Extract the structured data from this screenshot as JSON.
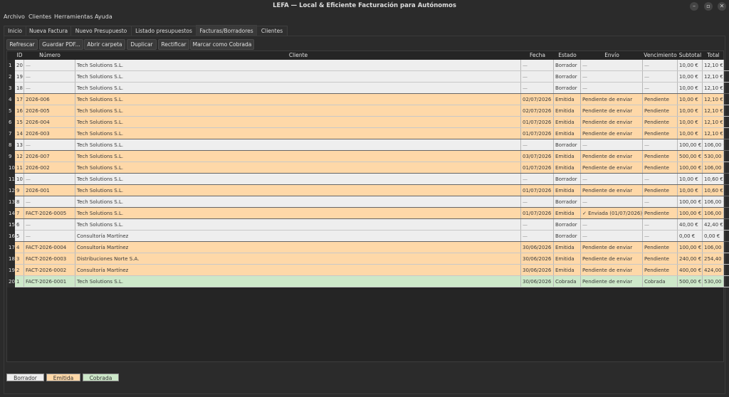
{
  "window": {
    "title": "LEFA — Local & Eficiente Facturación para Autónomos"
  },
  "menu": [
    "Archivo",
    "Clientes",
    "Herramientas",
    "Ayuda"
  ],
  "tabs": [
    "Inicio",
    "Nueva Factura",
    "Nuevo Presupuesto",
    "Listado presupuestos",
    "Facturas/Borradores",
    "Clientes"
  ],
  "active_tab": "Facturas/Borradores",
  "toolbar": [
    "Refrescar",
    "Guardar PDF...",
    "Abrir carpeta",
    "Duplicar",
    "Rectificar",
    "Marcar como Cobrada"
  ],
  "columns": [
    "ID",
    "Número",
    "Cliente",
    "Fecha",
    "Estado",
    "Envío",
    "Vencimiento",
    "Subtotal",
    "Total"
  ],
  "colors": {
    "borrador": "#eeeeee",
    "emitida": "#fed8a8",
    "cobrada": "#cde8c9"
  },
  "rows": [
    {
      "n": "1",
      "id": "20",
      "numero": "—",
      "cliente": "Tech Solutions S.L.",
      "fecha": "—",
      "estado": "Borrador",
      "envio": "—",
      "venc": "—",
      "subtotal": "10,00 €",
      "total": "12,10 €"
    },
    {
      "n": "2",
      "id": "19",
      "numero": "—",
      "cliente": "Tech Solutions S.L.",
      "fecha": "—",
      "estado": "Borrador",
      "envio": "—",
      "venc": "—",
      "subtotal": "10,00 €",
      "total": "12,10 €"
    },
    {
      "n": "3",
      "id": "18",
      "numero": "—",
      "cliente": "Tech Solutions S.L.",
      "fecha": "—",
      "estado": "Borrador",
      "envio": "—",
      "venc": "—",
      "subtotal": "10,00 €",
      "total": "12,10 €"
    },
    {
      "n": "4",
      "id": "17",
      "numero": "2026-006",
      "cliente": "Tech Solutions S.L.",
      "fecha": "02/07/2026",
      "estado": "Emitida",
      "envio": "Pendiente de enviar",
      "venc": "Pendiente",
      "subtotal": "10,00 €",
      "total": "12,10 €"
    },
    {
      "n": "5",
      "id": "16",
      "numero": "2026-005",
      "cliente": "Tech Solutions S.L.",
      "fecha": "02/07/2026",
      "estado": "Emitida",
      "envio": "Pendiente de enviar",
      "venc": "Pendiente",
      "subtotal": "10,00 €",
      "total": "12,10 €"
    },
    {
      "n": "6",
      "id": "15",
      "numero": "2026-004",
      "cliente": "Tech Solutions S.L.",
      "fecha": "01/07/2026",
      "estado": "Emitida",
      "envio": "Pendiente de enviar",
      "venc": "Pendiente",
      "subtotal": "10,00 €",
      "total": "12,10 €"
    },
    {
      "n": "7",
      "id": "14",
      "numero": "2026-003",
      "cliente": "Tech Solutions S.L.",
      "fecha": "01/07/2026",
      "estado": "Emitida",
      "envio": "Pendiente de enviar",
      "venc": "Pendiente",
      "subtotal": "10,00 €",
      "total": "12,10 €"
    },
    {
      "n": "8",
      "id": "13",
      "numero": "—",
      "cliente": "Tech Solutions S.L.",
      "fecha": "—",
      "estado": "Borrador",
      "envio": "—",
      "venc": "—",
      "subtotal": "100,00 €",
      "total": "106,00 €"
    },
    {
      "n": "9",
      "id": "12",
      "numero": "2026-007",
      "cliente": "Tech Solutions S.L.",
      "fecha": "03/07/2026",
      "estado": "Emitida",
      "envio": "Pendiente de enviar",
      "venc": "Pendiente",
      "subtotal": "500,00 €",
      "total": "530,00 €"
    },
    {
      "n": "10",
      "id": "11",
      "numero": "2026-002",
      "cliente": "Tech Solutions S.L.",
      "fecha": "01/07/2026",
      "estado": "Emitida",
      "envio": "Pendiente de enviar",
      "venc": "Pendiente",
      "subtotal": "100,00 €",
      "total": "106,00 €"
    },
    {
      "n": "11",
      "id": "10",
      "numero": "—",
      "cliente": "Tech Solutions S.L.",
      "fecha": "—",
      "estado": "Borrador",
      "envio": "—",
      "venc": "—",
      "subtotal": "10,00 €",
      "total": "10,60 €"
    },
    {
      "n": "12",
      "id": "9",
      "numero": "2026-001",
      "cliente": "Tech Solutions S.L.",
      "fecha": "01/07/2026",
      "estado": "Emitida",
      "envio": "Pendiente de enviar",
      "venc": "Pendiente",
      "subtotal": "10,00 €",
      "total": "10,60 €"
    },
    {
      "n": "13",
      "id": "8",
      "numero": "—",
      "cliente": "Tech Solutions S.L.",
      "fecha": "—",
      "estado": "Borrador",
      "envio": "—",
      "venc": "—",
      "subtotal": "100,00 €",
      "total": "106,00 €"
    },
    {
      "n": "14",
      "id": "7",
      "numero": "FACT-2026-0005",
      "cliente": "Tech Solutions S.L.",
      "fecha": "01/07/2026",
      "estado": "Emitida",
      "envio": "✓ Enviada (01/07/2026)",
      "venc": "Pendiente",
      "subtotal": "100,00 €",
      "total": "106,00 €"
    },
    {
      "n": "15",
      "id": "6",
      "numero": "—",
      "cliente": "Tech Solutions S.L.",
      "fecha": "—",
      "estado": "Borrador",
      "envio": "—",
      "venc": "—",
      "subtotal": "40,00 €",
      "total": "42,40 €"
    },
    {
      "n": "16",
      "id": "5",
      "numero": "—",
      "cliente": "Consultoría Martínez",
      "fecha": "—",
      "estado": "Borrador",
      "envio": "—",
      "venc": "—",
      "subtotal": "0,00 €",
      "total": "0,00 €"
    },
    {
      "n": "17",
      "id": "4",
      "numero": "FACT-2026-0004",
      "cliente": "Consultoría Martínez",
      "fecha": "30/06/2026",
      "estado": "Emitida",
      "envio": "Pendiente de enviar",
      "venc": "Pendiente",
      "subtotal": "100,00 €",
      "total": "106,00 €"
    },
    {
      "n": "18",
      "id": "3",
      "numero": "FACT-2026-0003",
      "cliente": "Distribuciones Norte S.A.",
      "fecha": "30/06/2026",
      "estado": "Emitida",
      "envio": "Pendiente de enviar",
      "venc": "Pendiente",
      "subtotal": "240,00 €",
      "total": "254,40 €"
    },
    {
      "n": "19",
      "id": "2",
      "numero": "FACT-2026-0002",
      "cliente": "Consultoría Martínez",
      "fecha": "30/06/2026",
      "estado": "Emitida",
      "envio": "Pendiente de enviar",
      "venc": "Pendiente",
      "subtotal": "400,00 €",
      "total": "424,00 €"
    },
    {
      "n": "20",
      "id": "1",
      "numero": "FACT-2026-0001",
      "cliente": "Tech Solutions S.L.",
      "fecha": "30/06/2026",
      "estado": "Cobrada",
      "envio": "Pendiente de enviar",
      "venc": "Cobrada",
      "subtotal": "500,00 €",
      "total": "530,00 €"
    }
  ],
  "legend": [
    "Borrador",
    "Emitida",
    "Cobrada"
  ]
}
